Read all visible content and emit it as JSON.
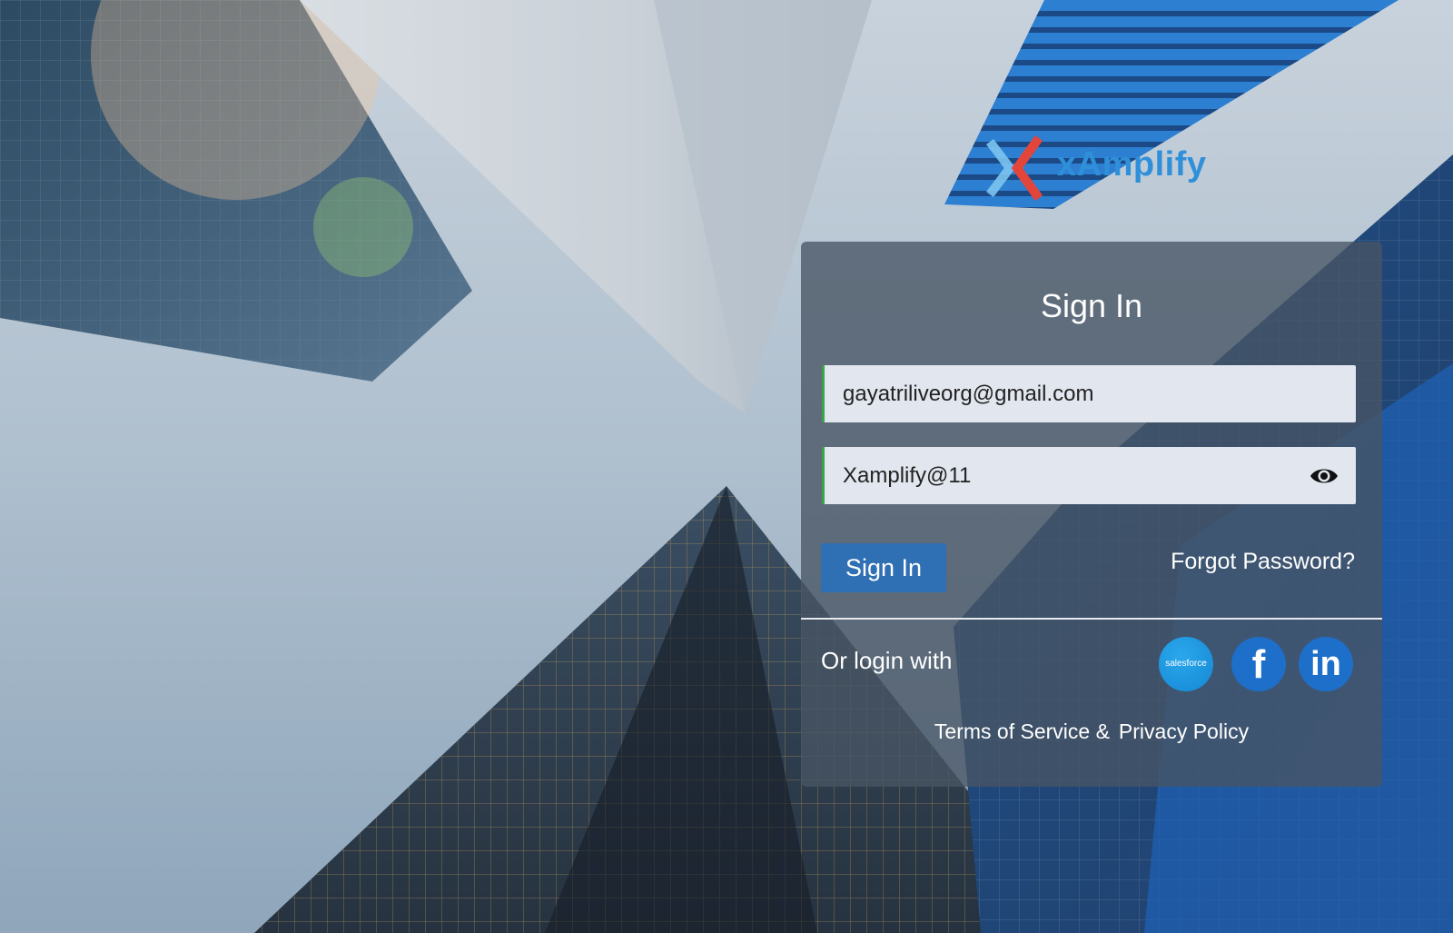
{
  "brand": {
    "name": "xAmplify",
    "logo_colors": {
      "chevron_light": "#7cc4ee",
      "chevron_red": "#e4453b",
      "text": "#2f8fd9"
    }
  },
  "signin": {
    "title": "Sign In",
    "email_value": "gayatriliveorg@gmail.com",
    "password_value": "Xamplify@11",
    "password_toggle_icon": "eye-icon",
    "submit_label": "Sign In",
    "forgot_label": "Forgot Password?",
    "or_login_label": "Or login with",
    "social": {
      "salesforce_label": "salesforce",
      "facebook_label": "f",
      "linkedin_label": "in"
    },
    "terms_label": "Terms of Service &",
    "privacy_label": "Privacy Policy"
  },
  "colors": {
    "card_bg": "rgba(72,84,100,0.78)",
    "field_bg": "#e1e6ef",
    "field_accent": "#3aa64a",
    "button": "#2f6fb3",
    "social": "#1d6fc9"
  }
}
